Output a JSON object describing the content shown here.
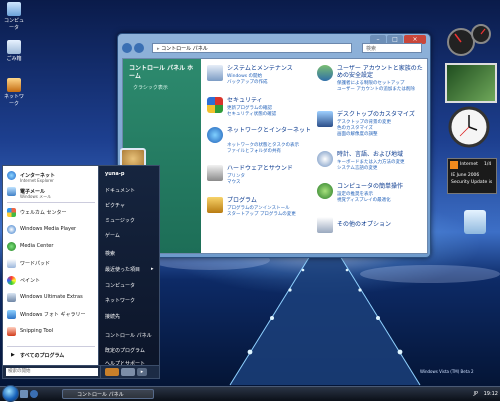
{
  "desktop": {
    "icons": [
      {
        "label": "コンピュータ"
      },
      {
        "label": "ごみ箱"
      },
      {
        "label": "ネットワーク"
      }
    ]
  },
  "gadgets": {
    "feed": {
      "title": "Internet",
      "count": "1/4",
      "line1": "IE June 2006",
      "line2": "Security Update is"
    },
    "watermark": "Windows Vista (TM) Beta 2"
  },
  "window": {
    "title": "コントロール パネル",
    "address": "コントロール パネル",
    "search_placeholder": "検索",
    "left_pane": {
      "title": "コントロール パネル ホーム",
      "link": "クラシック表示"
    },
    "categories": [
      {
        "head": "システムとメンテナンス",
        "subs": [
          "Windows の開始",
          "バックアップの作成"
        ]
      },
      {
        "head": "ユーザー アカウントと家族のための安全設定",
        "subs": [
          "保護者による制限のセットアップ",
          "ユーザー アカウントの追加または削除"
        ]
      },
      {
        "head": "セキュリティ",
        "subs": [
          "更新プログラムの確認",
          "セキュリティ状態の確認"
        ]
      },
      {
        "head": "デスクトップのカスタマイズ",
        "subs": [
          "デスクトップの背景の変更",
          "色のカスタマイズ",
          "画面の解像度の調整"
        ]
      },
      {
        "head": "ネットワークとインターネット",
        "subs": [
          "ネットワークの状態とタスクの表示",
          "ファイルとフォルダの共有"
        ]
      },
      {
        "head": "時計、言語、および地域",
        "subs": [
          "キーボードまたは入力方法の変更",
          "システム言語の変更"
        ]
      },
      {
        "head": "ハードウェアとサウンド",
        "subs": [
          "プリンタ",
          "マウス"
        ]
      },
      {
        "head": "コンピュータの簡単操作",
        "subs": [
          "設定の推奨を表示",
          "視覚ディスプレイの最適化"
        ]
      },
      {
        "head": "プログラム",
        "subs": [
          "プログラムのアンインストール",
          "スタートアップ プログラムの変更"
        ]
      },
      {
        "head": "その他のオプション",
        "subs": []
      }
    ]
  },
  "start_menu": {
    "pinned": [
      {
        "title": "インターネット",
        "sub": "Internet Explorer"
      },
      {
        "title": "電子メール",
        "sub": "Windows メール"
      }
    ],
    "recent": [
      {
        "title": "ウェルカム センター"
      },
      {
        "title": "Windows Media Player"
      },
      {
        "title": "Media Center"
      },
      {
        "title": "ワードパッド"
      },
      {
        "title": "ペイント"
      },
      {
        "title": "Windows Ultimate Extras"
      },
      {
        "title": "Windows フォト ギャラリー"
      },
      {
        "title": "Snipping Tool"
      }
    ],
    "all_programs": "すべてのプログラム",
    "search_placeholder": "検索の開始",
    "right": [
      "yuna-p",
      "ドキュメント",
      "ピクチャ",
      "ミュージック",
      "ゲーム",
      "検索",
      "最近使った項目",
      "コンピュータ",
      "ネットワーク",
      "接続先",
      "コントロール パネル",
      "既定のプログラム",
      "ヘルプとサポート"
    ]
  },
  "taskbar": {
    "task_label": "コントロール パネル",
    "lang": "JP",
    "clock": "19:12"
  }
}
